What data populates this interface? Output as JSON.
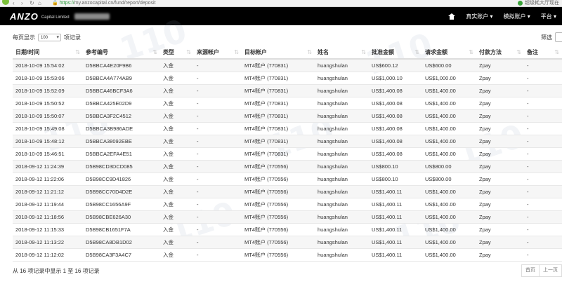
{
  "browser": {
    "url_scheme": "https://",
    "url_rest": "my.anzocapital.cn/fund/report/deposit",
    "right_text": "超级耗大厅现在"
  },
  "topbar": {
    "logo": "ANZO",
    "logo_sub": "Capital Limited",
    "home_icon": "home-icon",
    "menu": [
      {
        "label": "真实账户 ▾"
      },
      {
        "label": "模拟账户 ▾"
      },
      {
        "label": "平台 ▾"
      }
    ]
  },
  "controls": {
    "show_prefix": "每页显示",
    "page_size": "100",
    "show_suffix": "项记录",
    "filter_label": "筛选"
  },
  "table": {
    "headers": [
      "日期/时间",
      "参考编号",
      "类型",
      "来源帐户",
      "目标帐户",
      "姓名",
      "批准金额",
      "请求金额",
      "付款方法",
      "备注"
    ],
    "rows": [
      [
        "2018-10-09 15:54:02",
        "D5BBCA4E20F9B6",
        "入金",
        "-",
        "MT4账户 (770831)",
        "huangshulan",
        "US$600.12",
        "US$600.00",
        "Zpay",
        "-"
      ],
      [
        "2018-10-09 15:53:06",
        "D5BBCA4A774AB9",
        "入金",
        "-",
        "MT4账户 (770831)",
        "huangshulan",
        "US$1,000.10",
        "US$1,000.00",
        "Zpay",
        "-"
      ],
      [
        "2018-10-09 15:52:09",
        "D5BBCA46BCF3A6",
        "入金",
        "-",
        "MT4账户 (770831)",
        "huangshulan",
        "US$1,400.08",
        "US$1,400.00",
        "Zpay",
        "-"
      ],
      [
        "2018-10-09 15:50:52",
        "D5BBCA425E02D9",
        "入金",
        "-",
        "MT4账户 (770831)",
        "huangshulan",
        "US$1,400.08",
        "US$1,400.00",
        "Zpay",
        "-"
      ],
      [
        "2018-10-09 15:50:07",
        "D5BBCA3F2C4512",
        "入金",
        "-",
        "MT4账户 (770831)",
        "huangshulan",
        "US$1,400.08",
        "US$1,400.00",
        "Zpay",
        "-"
      ],
      [
        "2018-10-09 15:49:08",
        "D5BBCA3B986ADE",
        "入金",
        "-",
        "MT4账户 (770831)",
        "huangshulan",
        "US$1,400.08",
        "US$1,400.00",
        "Zpay",
        "-"
      ],
      [
        "2018-10-09 15:48:12",
        "D5BBCA38092EBE",
        "入金",
        "-",
        "MT4账户 (770831)",
        "huangshulan",
        "US$1,400.08",
        "US$1,400.00",
        "Zpay",
        "-"
      ],
      [
        "2018-10-09 15:46:51",
        "D5BBCA2EFA4E51",
        "入金",
        "-",
        "MT4账户 (770831)",
        "huangshulan",
        "US$1,400.08",
        "US$1,400.00",
        "Zpay",
        "-"
      ],
      [
        "2018-09-12 11:24:39",
        "D5B98CD3DCD085",
        "入金",
        "-",
        "MT4账户 (770556)",
        "huangshulan",
        "US$800.10",
        "US$800.00",
        "Zpay",
        "-"
      ],
      [
        "2018-09-12 11:22:06",
        "D5B98CC9D41826",
        "入金",
        "-",
        "MT4账户 (770556)",
        "huangshulan",
        "US$800.10",
        "US$800.00",
        "Zpay",
        "-"
      ],
      [
        "2018-09-12 11:21:12",
        "D5B98CC70D4D2E",
        "入金",
        "-",
        "MT4账户 (770556)",
        "huangshulan",
        "US$1,400.11",
        "US$1,400.00",
        "Zpay",
        "-"
      ],
      [
        "2018-09-12 11:19:44",
        "D5B98CC1656A9F",
        "入金",
        "-",
        "MT4账户 (770556)",
        "huangshulan",
        "US$1,400.11",
        "US$1,400.00",
        "Zpay",
        "-"
      ],
      [
        "2018-09-12 11:18:56",
        "D5B98CBE626A30",
        "入金",
        "-",
        "MT4账户 (770556)",
        "huangshulan",
        "US$1,400.11",
        "US$1,400.00",
        "Zpay",
        "-"
      ],
      [
        "2018-09-12 11:15:33",
        "D5B98CB1651F7A",
        "入金",
        "-",
        "MT4账户 (770556)",
        "huangshulan",
        "US$1,400.11",
        "US$1,400.00",
        "Zpay",
        "-"
      ],
      [
        "2018-09-12 11:13:22",
        "D5B98CA8DB1D02",
        "入金",
        "-",
        "MT4账户 (770556)",
        "huangshulan",
        "US$1,400.11",
        "US$1,400.00",
        "Zpay",
        "-"
      ],
      [
        "2018-09-12 11:12:02",
        "D5B98CA3F3A4C7",
        "入金",
        "-",
        "MT4账户 (770556)",
        "huangshulan",
        "US$1,400.11",
        "US$1,400.00",
        "Zpay",
        "-"
      ]
    ]
  },
  "footer": {
    "summary": "从 16 项记录中显示 1 至 16 项记录",
    "prev": "首页",
    "prev2": "上一页"
  },
  "watermark": "110"
}
